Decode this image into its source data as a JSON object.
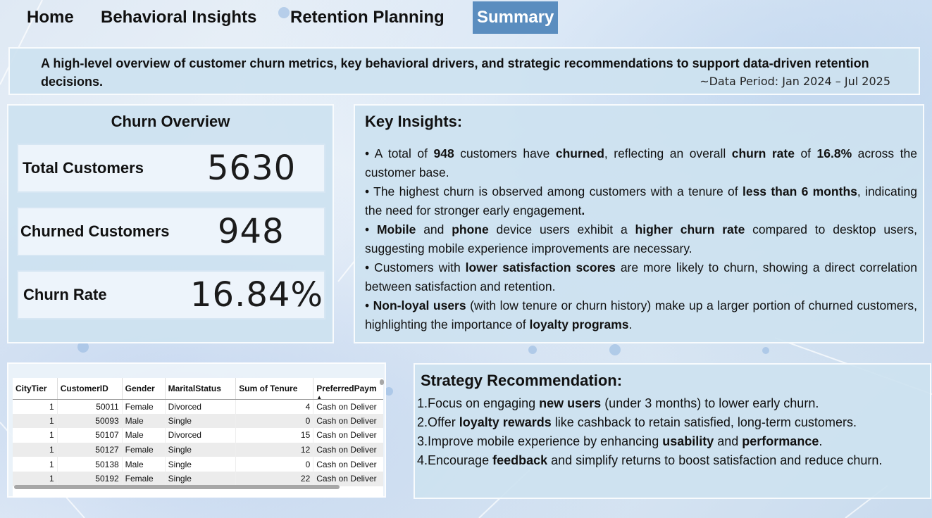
{
  "nav": {
    "tabs": [
      {
        "label": "Home"
      },
      {
        "label": "Behavioral Insights"
      },
      {
        "label": "Retention Planning"
      },
      {
        "label": "Summary"
      }
    ],
    "active": "Summary"
  },
  "header": {
    "description": "A high-level overview of customer churn metrics, key behavioral drivers, and strategic recommendations to support data-driven retention decisions.",
    "period": "~Data Period: Jan 2024 – Jul 2025"
  },
  "overview": {
    "title": "Churn Overview",
    "kpis": [
      {
        "label": "Total Customers",
        "value": "5630"
      },
      {
        "label": "Churned Customers",
        "value": "948"
      },
      {
        "label": "Churn Rate",
        "value": "16.84%"
      }
    ]
  },
  "insights": {
    "title": "Key Insights:",
    "items": [
      [
        {
          "t": "• A total of "
        },
        {
          "t": "948",
          "b": true
        },
        {
          "t": " customers have "
        },
        {
          "t": "churned",
          "b": true
        },
        {
          "t": ", reflecting an overall "
        },
        {
          "t": "churn rate",
          "b": true
        },
        {
          "t": " of "
        },
        {
          "t": "16.8%",
          "b": true
        },
        {
          "t": " across the customer base."
        }
      ],
      [
        {
          "t": "• The highest churn is observed among customers with a tenure of "
        },
        {
          "t": "less than 6 months",
          "b": true
        },
        {
          "t": ", indicating the need for stronger early engagement"
        },
        {
          "t": ".",
          "b": true
        }
      ],
      [
        {
          "t": "• "
        },
        {
          "t": "Mobile",
          "b": true
        },
        {
          "t": " and "
        },
        {
          "t": "phone",
          "b": true
        },
        {
          "t": " device users exhibit a "
        },
        {
          "t": "higher churn rate",
          "b": true
        },
        {
          "t": " compared to desktop users, suggesting mobile experience improvements are necessary."
        }
      ],
      [
        {
          "t": "• Customers with "
        },
        {
          "t": "lower satisfaction scores",
          "b": true
        },
        {
          "t": " are more likely to churn, showing a direct correlation between satisfaction and retention."
        }
      ],
      [
        {
          "t": "• "
        },
        {
          "t": "Non-loyal users",
          "b": true
        },
        {
          "t": " (with low tenure or churn history) make up a larger portion of churned customers, highlighting the importance of "
        },
        {
          "t": "loyalty programs",
          "b": true
        },
        {
          "t": "."
        }
      ]
    ]
  },
  "table": {
    "columns": [
      "CityTier",
      "CustomerID",
      "Gender",
      "MaritalStatus",
      "Sum of Tenure",
      "PreferredPaym"
    ],
    "sort_indicator": "▲",
    "rows": [
      [
        "1",
        "50011",
        "Female",
        "Divorced",
        "4",
        "Cash on Deliver"
      ],
      [
        "1",
        "50093",
        "Male",
        "Single",
        "0",
        "Cash on Deliver"
      ],
      [
        "1",
        "50107",
        "Male",
        "Divorced",
        "15",
        "Cash on Deliver"
      ],
      [
        "1",
        "50127",
        "Female",
        "Single",
        "12",
        "Cash on Deliver"
      ],
      [
        "1",
        "50138",
        "Male",
        "Single",
        "0",
        "Cash on Deliver"
      ],
      [
        "1",
        "50192",
        "Female",
        "Single",
        "22",
        "Cash on Deliver"
      ]
    ]
  },
  "strategy": {
    "title": "Strategy Recommendation:",
    "items": [
      [
        {
          "t": "1.Focus on engaging "
        },
        {
          "t": "new users",
          "b": true
        },
        {
          "t": " (under 3 months) to lower early churn."
        }
      ],
      [
        {
          "t": "2.Offer "
        },
        {
          "t": "loyalty rewards",
          "b": true
        },
        {
          "t": " like cashback to retain satisfied, long-term customers."
        }
      ],
      [
        {
          "t": "3.Improve mobile experience by enhancing "
        },
        {
          "t": "usability",
          "b": true
        },
        {
          "t": " and "
        },
        {
          "t": "performance",
          "b": true
        },
        {
          "t": "."
        }
      ],
      [
        {
          "t": "4.Encourage "
        },
        {
          "t": "feedback",
          "b": true
        },
        {
          "t": " and simplify returns to boost satisfaction and reduce churn."
        }
      ]
    ]
  },
  "colors": {
    "active_tab": "#5a8dbf",
    "panel_bg": "#cde2f0",
    "kpi_card_bg": "#edf4fb"
  }
}
